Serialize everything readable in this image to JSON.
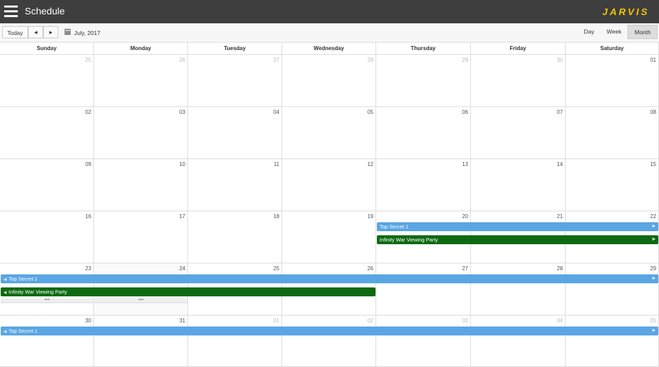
{
  "header": {
    "title": "Schedule",
    "logo_text": "JARVIS",
    "logo_color": "#f2c500",
    "bar_color": "#3e3e3e"
  },
  "toolbar": {
    "today_label": "Today",
    "prev_icon": "◀",
    "next_icon": "▶",
    "period_label": "July, 2017",
    "views": [
      {
        "label": "Day",
        "active": false
      },
      {
        "label": "Week",
        "active": false
      },
      {
        "label": "Month",
        "active": true
      }
    ]
  },
  "calendar": {
    "weekdays": [
      "Sunday",
      "Monday",
      "Tuesday",
      "Wednesday",
      "Thursday",
      "Friday",
      "Saturday"
    ],
    "weeks": [
      [
        {
          "d": "25",
          "other": true
        },
        {
          "d": "26",
          "other": true
        },
        {
          "d": "27",
          "other": true
        },
        {
          "d": "28",
          "other": true
        },
        {
          "d": "29",
          "other": true
        },
        {
          "d": "30",
          "other": true
        },
        {
          "d": "01",
          "other": false
        }
      ],
      [
        {
          "d": "02",
          "other": false
        },
        {
          "d": "03",
          "other": false
        },
        {
          "d": "04",
          "other": false
        },
        {
          "d": "05",
          "other": false
        },
        {
          "d": "06",
          "other": false
        },
        {
          "d": "07",
          "other": false
        },
        {
          "d": "08",
          "other": false
        }
      ],
      [
        {
          "d": "09",
          "other": false
        },
        {
          "d": "10",
          "other": false
        },
        {
          "d": "11",
          "other": false
        },
        {
          "d": "12",
          "other": false
        },
        {
          "d": "13",
          "other": false
        },
        {
          "d": "14",
          "other": false
        },
        {
          "d": "15",
          "other": false
        }
      ],
      [
        {
          "d": "16",
          "other": false
        },
        {
          "d": "17",
          "other": false
        },
        {
          "d": "18",
          "other": false
        },
        {
          "d": "19",
          "other": false
        },
        {
          "d": "20",
          "other": false
        },
        {
          "d": "21",
          "other": false
        },
        {
          "d": "22",
          "other": false
        }
      ],
      [
        {
          "d": "23",
          "other": false
        },
        {
          "d": "24",
          "other": false
        },
        {
          "d": "25",
          "other": false
        },
        {
          "d": "26",
          "other": false
        },
        {
          "d": "27",
          "other": false
        },
        {
          "d": "28",
          "other": false
        },
        {
          "d": "29",
          "other": false
        }
      ],
      [
        {
          "d": "30",
          "other": false
        },
        {
          "d": "31",
          "other": false
        },
        {
          "d": "01",
          "other": true
        },
        {
          "d": "02",
          "other": true
        },
        {
          "d": "03",
          "other": true
        },
        {
          "d": "04",
          "other": true
        },
        {
          "d": "05",
          "other": true
        }
      ]
    ],
    "events": [
      {
        "title": "Top Secret 1",
        "color": "blue",
        "week": 3,
        "start": 4,
        "end": 6,
        "slot": 0,
        "cont_left": false,
        "cont_right": true
      },
      {
        "title": "Infinity War Viewing Party",
        "color": "green",
        "week": 3,
        "start": 4,
        "end": 6,
        "slot": 1,
        "cont_left": false,
        "cont_right": true
      },
      {
        "title": "Top Secret 1",
        "color": "blue",
        "week": 4,
        "start": 0,
        "end": 6,
        "slot": 0,
        "cont_left": true,
        "cont_right": true
      },
      {
        "title": "Infinity War Viewing Party",
        "color": "green",
        "week": 4,
        "start": 0,
        "end": 3,
        "slot": 1,
        "cont_left": true,
        "cont_right": false
      },
      {
        "title": "Top Secret 1",
        "color": "blue",
        "week": 5,
        "start": 0,
        "end": 6,
        "slot": 0,
        "cont_left": true,
        "cont_right": true
      }
    ],
    "more_links": [
      {
        "week": 4,
        "col": 0,
        "label": "•••"
      },
      {
        "week": 4,
        "col": 1,
        "label": "•••"
      }
    ],
    "colors": {
      "blue": "#5aa6e4",
      "green": "#0e6a12"
    }
  }
}
